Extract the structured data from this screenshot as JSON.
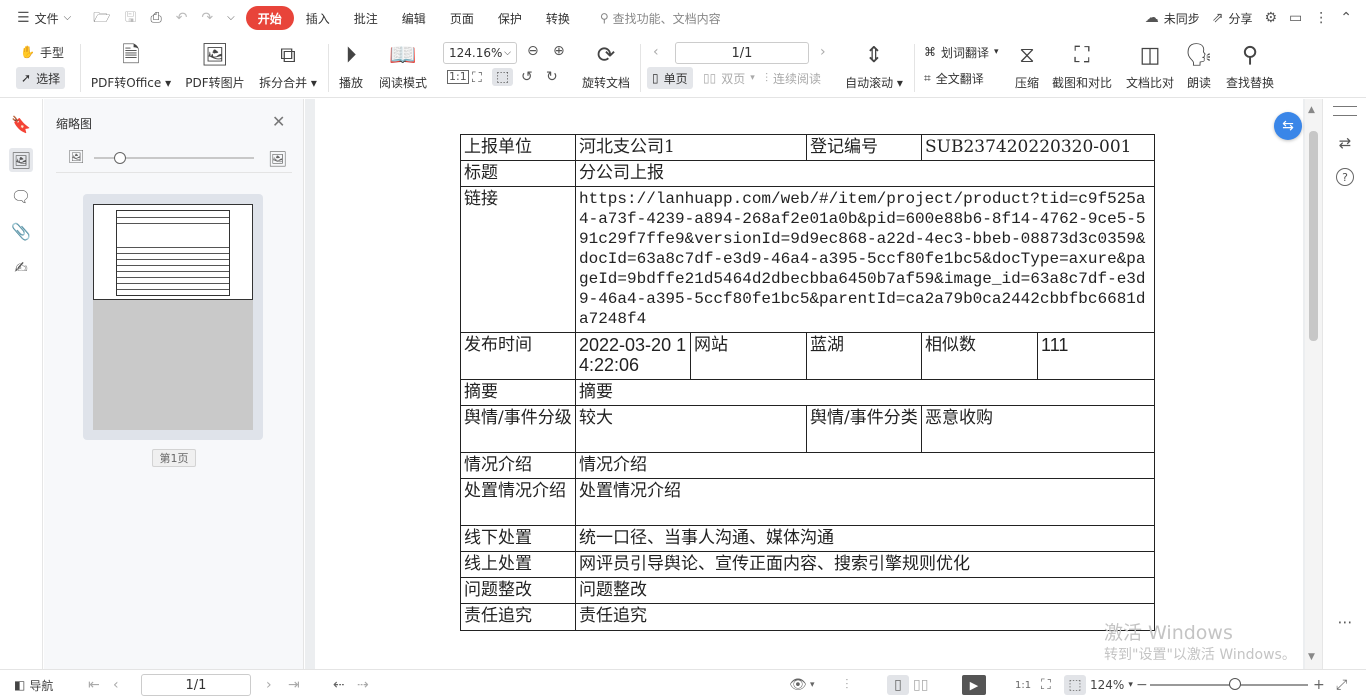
{
  "menu": {
    "file_label": "文件",
    "tabs": [
      "开始",
      "插入",
      "批注",
      "编辑",
      "页面",
      "保护",
      "转换"
    ],
    "search_placeholder": "查找功能、文档内容",
    "sync_label": "未同步",
    "share_label": "分享"
  },
  "ribbon": {
    "hand_label": "手型",
    "select_label": "选择",
    "pdf_office_label": "PDF转Office",
    "pdf_image_label": "PDF转图片",
    "split_merge_label": "拆分合并",
    "play_label": "播放",
    "read_mode_label": "阅读模式",
    "zoom_value": "124.16%",
    "rotate_label": "旋转文档",
    "page_value": "1/1",
    "single_label": "单页",
    "double_label": "双页",
    "continuous_label": "连续阅读",
    "auto_scroll_label": "自动滚动",
    "word_translate_label": "划词翻译",
    "full_translate_label": "全文翻译",
    "compress_label": "压缩",
    "crop_compare_label": "截图和对比",
    "doc_compare_label": "文档比对",
    "read_aloud_label": "朗读",
    "find_replace_label": "查找替换"
  },
  "thumbnail_panel": {
    "title": "缩略图",
    "page_label": "第1页"
  },
  "document": {
    "rows": [
      {
        "cells": [
          {
            "text": "上报单位",
            "colspan": 1
          },
          {
            "text": "河北支公司1",
            "colspan": 2
          },
          {
            "text": "登记编号",
            "colspan": 1
          },
          {
            "text": "SUB237420220320-001",
            "colspan": 2
          }
        ]
      },
      {
        "cells": [
          {
            "text": "标题",
            "colspan": 1
          },
          {
            "text": "分公司上报",
            "colspan": 5
          }
        ]
      },
      {
        "cells": [
          {
            "text": "链接",
            "colspan": 1
          },
          {
            "text": "https://lanhuapp.com/web/#/item/project/product?tid=c9f525a4-a73f-4239-a894-268af2e01a0b&pid=600e88b6-8f14-4762-9ce5-591c29f7ffe9&versionId=9d9ec868-a22d-4ec3-bbeb-08873d3c0359&docId=63a8c7df-e3d9-46a4-a395-5ccf80fe1bc5&docType=axure&pageId=9bdffe21d5464d2dbecbba6450b7af59&image_id=63a8c7df-e3d9-46a4-a395-5ccf80fe1bc5&parentId=ca2a79b0ca2442cbbfbc6681da7248f4",
            "colspan": 5,
            "style": "mono"
          }
        ]
      },
      {
        "cells": [
          {
            "text": "发布时间",
            "colspan": 1
          },
          {
            "text": "2022-03-20 14:22:06",
            "colspan": 1,
            "style": "sans"
          },
          {
            "text": "网站",
            "colspan": 1
          },
          {
            "text": "蓝湖",
            "colspan": 1
          },
          {
            "text": "相似数",
            "colspan": 1
          },
          {
            "text": "111",
            "colspan": 1,
            "style": "sans"
          }
        ]
      },
      {
        "cells": [
          {
            "text": "摘要",
            "colspan": 1
          },
          {
            "text": "摘要",
            "colspan": 5
          }
        ]
      },
      {
        "cells": [
          {
            "text": "舆情/事件分级",
            "colspan": 1
          },
          {
            "text": "较大",
            "colspan": 2
          },
          {
            "text": "舆情/事件分类",
            "colspan": 1
          },
          {
            "text": "恶意收购",
            "colspan": 2
          }
        ]
      },
      {
        "cells": [
          {
            "text": "情况介绍",
            "colspan": 1
          },
          {
            "text": "情况介绍",
            "colspan": 5
          }
        ]
      },
      {
        "cells": [
          {
            "text": "处置情况介绍",
            "colspan": 1
          },
          {
            "text": "处置情况介绍",
            "colspan": 5
          }
        ]
      },
      {
        "cells": [
          {
            "text": "线下处置",
            "colspan": 1
          },
          {
            "text": "统一口径、当事人沟通、媒体沟通",
            "colspan": 5
          }
        ]
      },
      {
        "cells": [
          {
            "text": "线上处置",
            "colspan": 1
          },
          {
            "text": "网评员引导舆论、宣传正面内容、搜索引擎规则优化",
            "colspan": 5
          }
        ]
      },
      {
        "cells": [
          {
            "text": "问题整改",
            "colspan": 1
          },
          {
            "text": "问题整改",
            "colspan": 5
          }
        ]
      },
      {
        "cells": [
          {
            "text": "责任追究",
            "colspan": 1
          },
          {
            "text": "责任追究",
            "colspan": 5
          }
        ]
      }
    ]
  },
  "watermark": {
    "line1": "激活 Windows",
    "line2": "转到\"设置\"以激活 Windows。"
  },
  "statusbar": {
    "nav_label": "导航",
    "page_value": "1/1",
    "zoom_value": "124%"
  }
}
